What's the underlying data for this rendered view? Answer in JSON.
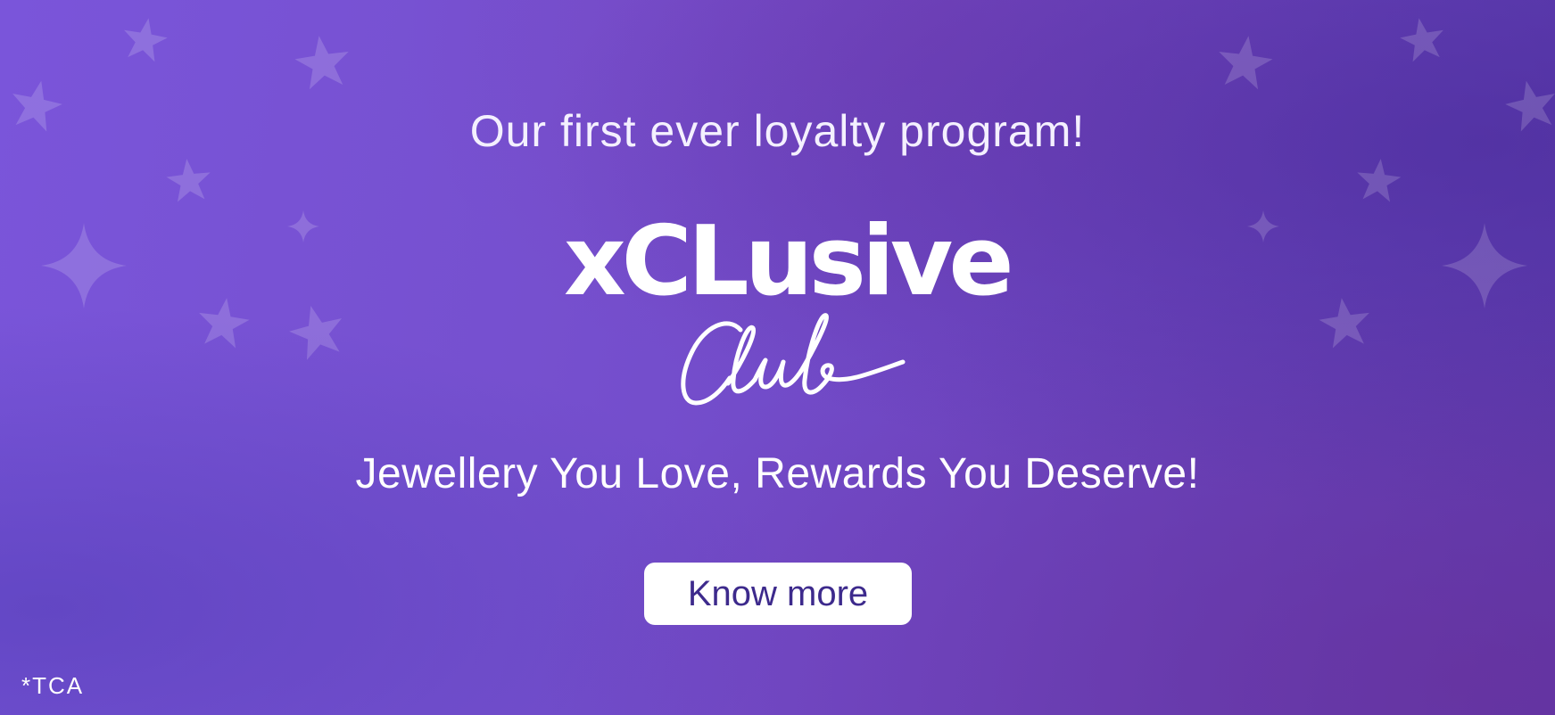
{
  "banner": {
    "tagline": "Our first ever loyalty program!",
    "logo": {
      "wordmark": "xCLusive",
      "script": "Club"
    },
    "subtitle": "Jewellery You Love, Rewards You Deserve!",
    "cta_label": "Know more",
    "footnote": "*TCA"
  },
  "colors": {
    "background_start": "#7a55da",
    "background_end": "#5e3db0",
    "text": "#ffffff",
    "button_bg": "#ffffff",
    "button_text": "#3d2a8c"
  },
  "icons": [
    "sparkle-star-icon"
  ]
}
